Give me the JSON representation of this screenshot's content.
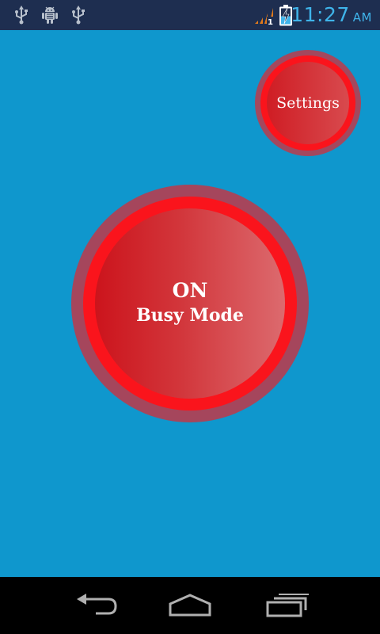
{
  "status_bar": {
    "icons": [
      "usb-icon",
      "android-debug-icon",
      "usb-icon",
      "signal-icon",
      "battery-charging-icon"
    ],
    "signal_badge": "1",
    "time": "11:27",
    "ampm": "AM",
    "clock_color": "#3fb4ea"
  },
  "app": {
    "background_color": "#0f97cd",
    "accent_color": "#fa141c",
    "settings_button": {
      "label": "Settings"
    },
    "busy_toggle": {
      "state": "ON",
      "label": "Busy Mode"
    }
  },
  "nav_bar": {
    "buttons": [
      "back-icon",
      "home-icon",
      "recents-icon"
    ]
  }
}
